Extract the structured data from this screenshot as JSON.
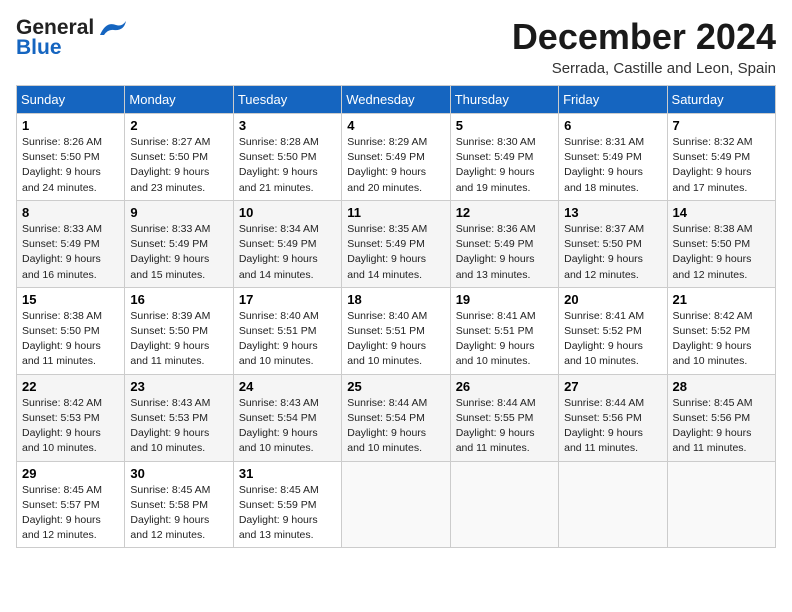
{
  "logo": {
    "line1": "General",
    "line2": "Blue"
  },
  "title": "December 2024",
  "location": "Serrada, Castille and Leon, Spain",
  "headers": [
    "Sunday",
    "Monday",
    "Tuesday",
    "Wednesday",
    "Thursday",
    "Friday",
    "Saturday"
  ],
  "weeks": [
    [
      {
        "day": "1",
        "sunrise": "8:26 AM",
        "sunset": "5:50 PM",
        "daylight": "9 hours and 24 minutes."
      },
      {
        "day": "2",
        "sunrise": "8:27 AM",
        "sunset": "5:50 PM",
        "daylight": "9 hours and 23 minutes."
      },
      {
        "day": "3",
        "sunrise": "8:28 AM",
        "sunset": "5:50 PM",
        "daylight": "9 hours and 21 minutes."
      },
      {
        "day": "4",
        "sunrise": "8:29 AM",
        "sunset": "5:49 PM",
        "daylight": "9 hours and 20 minutes."
      },
      {
        "day": "5",
        "sunrise": "8:30 AM",
        "sunset": "5:49 PM",
        "daylight": "9 hours and 19 minutes."
      },
      {
        "day": "6",
        "sunrise": "8:31 AM",
        "sunset": "5:49 PM",
        "daylight": "9 hours and 18 minutes."
      },
      {
        "day": "7",
        "sunrise": "8:32 AM",
        "sunset": "5:49 PM",
        "daylight": "9 hours and 17 minutes."
      }
    ],
    [
      {
        "day": "8",
        "sunrise": "8:33 AM",
        "sunset": "5:49 PM",
        "daylight": "9 hours and 16 minutes."
      },
      {
        "day": "9",
        "sunrise": "8:33 AM",
        "sunset": "5:49 PM",
        "daylight": "9 hours and 15 minutes."
      },
      {
        "day": "10",
        "sunrise": "8:34 AM",
        "sunset": "5:49 PM",
        "daylight": "9 hours and 14 minutes."
      },
      {
        "day": "11",
        "sunrise": "8:35 AM",
        "sunset": "5:49 PM",
        "daylight": "9 hours and 14 minutes."
      },
      {
        "day": "12",
        "sunrise": "8:36 AM",
        "sunset": "5:49 PM",
        "daylight": "9 hours and 13 minutes."
      },
      {
        "day": "13",
        "sunrise": "8:37 AM",
        "sunset": "5:50 PM",
        "daylight": "9 hours and 12 minutes."
      },
      {
        "day": "14",
        "sunrise": "8:38 AM",
        "sunset": "5:50 PM",
        "daylight": "9 hours and 12 minutes."
      }
    ],
    [
      {
        "day": "15",
        "sunrise": "8:38 AM",
        "sunset": "5:50 PM",
        "daylight": "9 hours and 11 minutes."
      },
      {
        "day": "16",
        "sunrise": "8:39 AM",
        "sunset": "5:50 PM",
        "daylight": "9 hours and 11 minutes."
      },
      {
        "day": "17",
        "sunrise": "8:40 AM",
        "sunset": "5:51 PM",
        "daylight": "9 hours and 10 minutes."
      },
      {
        "day": "18",
        "sunrise": "8:40 AM",
        "sunset": "5:51 PM",
        "daylight": "9 hours and 10 minutes."
      },
      {
        "day": "19",
        "sunrise": "8:41 AM",
        "sunset": "5:51 PM",
        "daylight": "9 hours and 10 minutes."
      },
      {
        "day": "20",
        "sunrise": "8:41 AM",
        "sunset": "5:52 PM",
        "daylight": "9 hours and 10 minutes."
      },
      {
        "day": "21",
        "sunrise": "8:42 AM",
        "sunset": "5:52 PM",
        "daylight": "9 hours and 10 minutes."
      }
    ],
    [
      {
        "day": "22",
        "sunrise": "8:42 AM",
        "sunset": "5:53 PM",
        "daylight": "9 hours and 10 minutes."
      },
      {
        "day": "23",
        "sunrise": "8:43 AM",
        "sunset": "5:53 PM",
        "daylight": "9 hours and 10 minutes."
      },
      {
        "day": "24",
        "sunrise": "8:43 AM",
        "sunset": "5:54 PM",
        "daylight": "9 hours and 10 minutes."
      },
      {
        "day": "25",
        "sunrise": "8:44 AM",
        "sunset": "5:54 PM",
        "daylight": "9 hours and 10 minutes."
      },
      {
        "day": "26",
        "sunrise": "8:44 AM",
        "sunset": "5:55 PM",
        "daylight": "9 hours and 11 minutes."
      },
      {
        "day": "27",
        "sunrise": "8:44 AM",
        "sunset": "5:56 PM",
        "daylight": "9 hours and 11 minutes."
      },
      {
        "day": "28",
        "sunrise": "8:45 AM",
        "sunset": "5:56 PM",
        "daylight": "9 hours and 11 minutes."
      }
    ],
    [
      {
        "day": "29",
        "sunrise": "8:45 AM",
        "sunset": "5:57 PM",
        "daylight": "9 hours and 12 minutes."
      },
      {
        "day": "30",
        "sunrise": "8:45 AM",
        "sunset": "5:58 PM",
        "daylight": "9 hours and 12 minutes."
      },
      {
        "day": "31",
        "sunrise": "8:45 AM",
        "sunset": "5:59 PM",
        "daylight": "9 hours and 13 minutes."
      },
      null,
      null,
      null,
      null
    ]
  ],
  "labels": {
    "sunrise": "Sunrise:",
    "sunset": "Sunset:",
    "daylight": "Daylight:"
  }
}
